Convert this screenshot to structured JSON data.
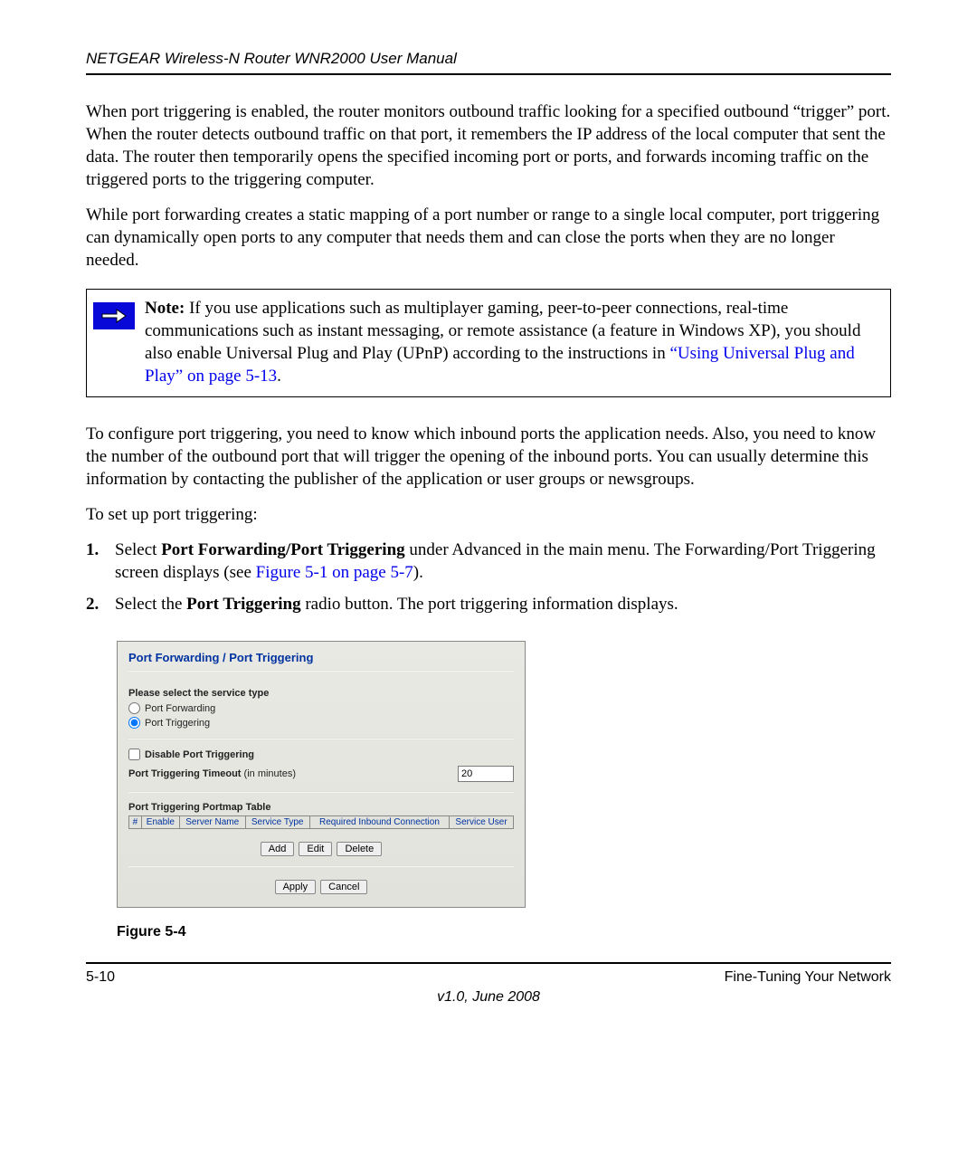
{
  "header": {
    "title": "NETGEAR Wireless-N Router WNR2000 User Manual"
  },
  "body": {
    "p1": "When port triggering is enabled, the router monitors outbound traffic looking for a specified outbound “trigger” port. When the router detects outbound traffic on that port, it remembers the IP address of the local computer that sent the data. The router then temporarily opens the specified incoming port or ports, and forwards incoming traffic on the triggered ports to the triggering computer.",
    "p2": "While port forwarding creates a static mapping of a port number or range to a single local computer, port triggering can dynamically open ports to any computer that needs them and can close the ports when they are no longer needed.",
    "note_label": "Note:",
    "note_body_a": " If you use applications such as multiplayer gaming, peer-to-peer connections, real-time communications such as instant messaging, or remote assistance (a feature in Windows XP), you should also enable Universal Plug and Play (UPnP) according to the instructions in ",
    "note_link": "“Using Universal Plug and Play” on page 5-13",
    "note_period": ".",
    "p3": "To configure port triggering, you need to know which inbound ports the application needs. Also, you need to know the number of the outbound port that will trigger the opening of the inbound ports. You can usually determine this information by contacting the publisher of the application or user groups or newsgroups.",
    "p4": "To set up port triggering:",
    "step1_num": "1.",
    "step1_a": "Select ",
    "step1_bold": "Port Forwarding/Port Triggering",
    "step1_b": " under Advanced in the main menu. The Forwarding/Port Triggering screen displays (see ",
    "step1_link": "Figure 5-1 on page 5-7",
    "step1_c": ").",
    "step2_num": "2.",
    "step2_a": "Select the ",
    "step2_bold": "Port Triggering",
    "step2_b": " radio button. The port triggering information displays."
  },
  "ui": {
    "title": "Port Forwarding / Port Triggering",
    "select_label": "Please select the service type",
    "radio_forwarding": "Port Forwarding",
    "radio_triggering": "Port Triggering",
    "disable_label": "Disable Port Triggering",
    "timeout_label_bold": "Port Triggering Timeout",
    "timeout_label_rest": " (in minutes)",
    "timeout_value": "20",
    "portmap_label": "Port Triggering Portmap Table",
    "cols": {
      "hash": "#",
      "enable": "Enable",
      "server": "Server Name",
      "svctype": "Service Type",
      "reqin": "Required Inbound Connection",
      "svcuser": "Service User"
    },
    "btn_add": "Add",
    "btn_edit": "Edit",
    "btn_delete": "Delete",
    "btn_apply": "Apply",
    "btn_cancel": "Cancel"
  },
  "figure_caption": "Figure 5-4",
  "footer": {
    "page": "5-10",
    "section": "Fine-Tuning Your Network",
    "version": "v1.0, June 2008"
  }
}
